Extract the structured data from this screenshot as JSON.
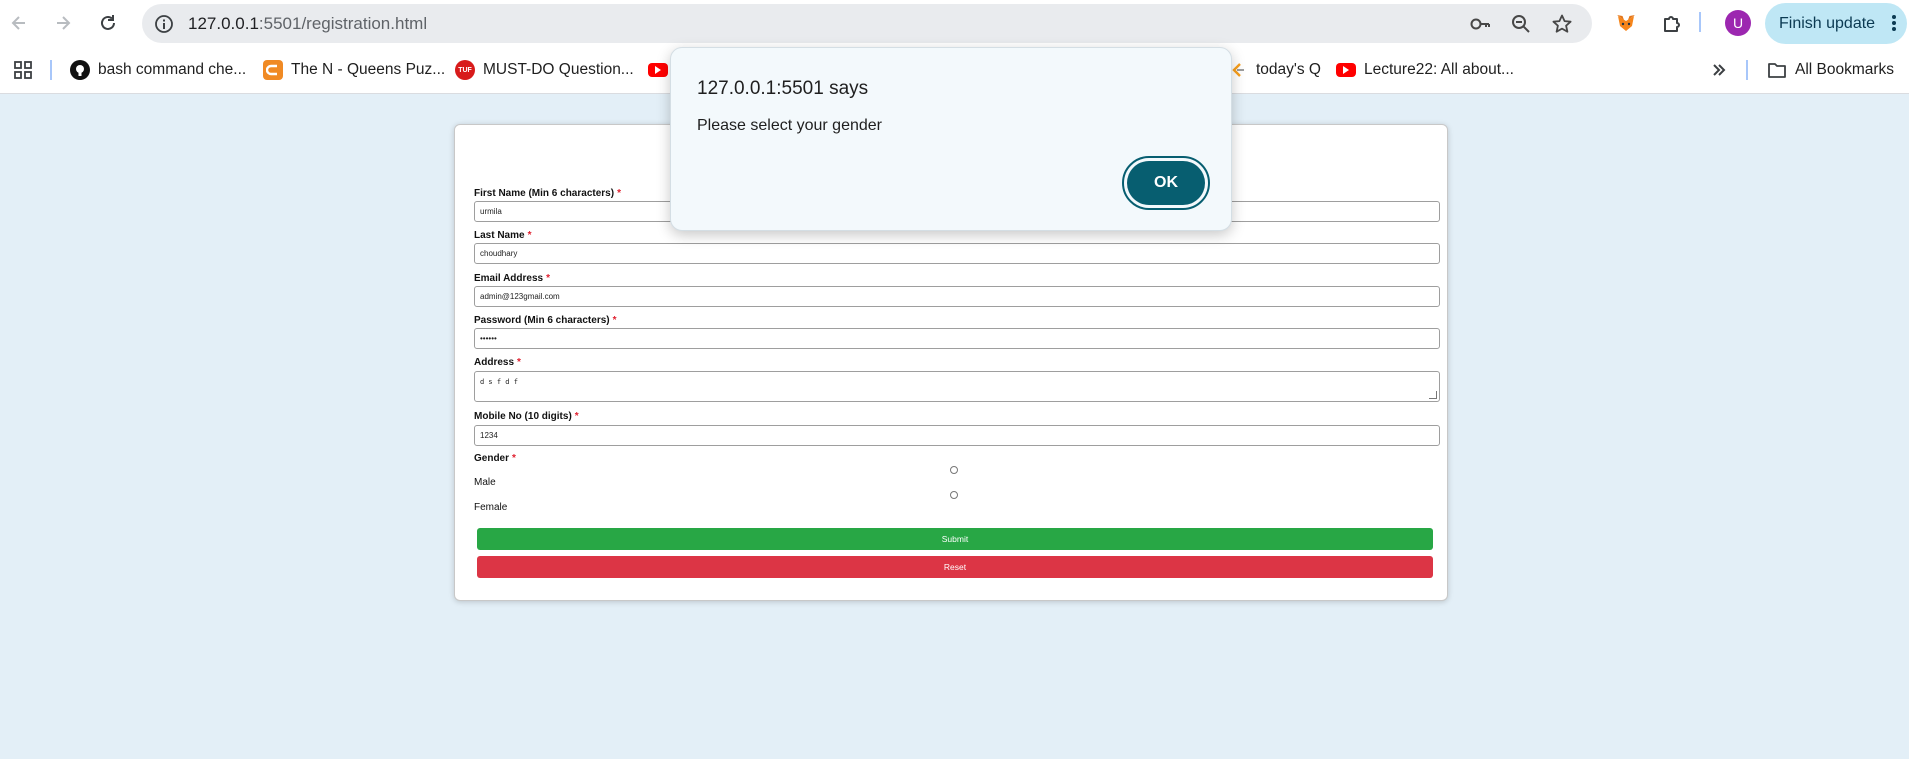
{
  "browser": {
    "url_host": "127.0.0.1",
    "url_path": ":5501/registration.html",
    "finish_update_label": "Finish update",
    "avatar_letter": "U",
    "bookmarks": [
      {
        "label": "bash command che...",
        "icon": "github-icon"
      },
      {
        "label": "The N - Queens Puz...",
        "icon": "bookmark-favicon"
      },
      {
        "label": "MUST-DO Question...",
        "icon": "tuf-icon"
      },
      {
        "label": "today's Q",
        "icon": "leetcode-icon"
      },
      {
        "label": "Lecture22: All about...",
        "icon": "youtube-icon"
      }
    ],
    "all_bookmarks_label": "All Bookmarks"
  },
  "form": {
    "fields": [
      {
        "label": "First Name (Min 6 characters)",
        "required": "*",
        "value": "urmila"
      },
      {
        "label": "Last Name",
        "required": "*",
        "value": "choudhary"
      },
      {
        "label": "Email Address",
        "required": "*",
        "value": "admin@123gmail.com"
      },
      {
        "label": "Password (Min 6 characters)",
        "required": "*",
        "value": "••••••"
      },
      {
        "label": "Address",
        "required": "*",
        "value": "d s f d f"
      },
      {
        "label": "Mobile No (10 digits)",
        "required": "*",
        "value": "1234"
      }
    ],
    "gender": {
      "label": "Gender",
      "required": "*",
      "options": [
        "Male",
        "Female"
      ]
    },
    "submit_label": "Submit",
    "reset_label": "Reset"
  },
  "dialog": {
    "title": "127.0.0.1:5501 says",
    "message": "Please select your gender",
    "ok_label": "OK"
  },
  "colors": {
    "page_background": "#e3eff7",
    "submit": "#28a745",
    "reset": "#dc3545",
    "dialog_ok": "#075e70",
    "required_star": "#e0202f"
  }
}
